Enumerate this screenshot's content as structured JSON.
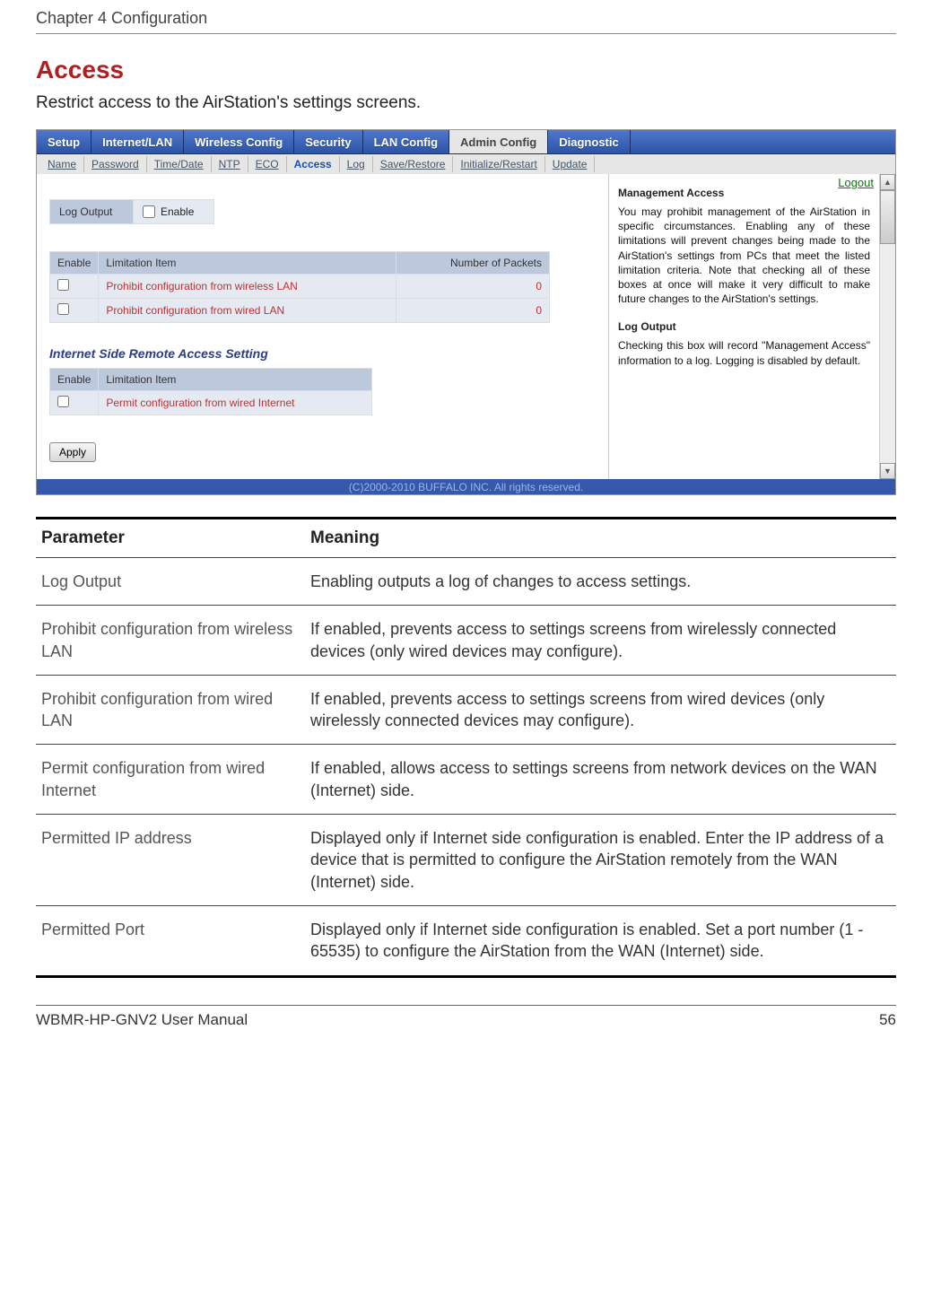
{
  "page_header": {
    "chapter": "Chapter 4  Configuration"
  },
  "section": {
    "title": "Access",
    "description": "Restrict access to the AirStation's settings screens."
  },
  "tabs": {
    "setup": "Setup",
    "internet_lan": "Internet/LAN",
    "wireless": "Wireless Config",
    "security": "Security",
    "lan_config": "LAN Config",
    "admin_config": "Admin Config",
    "diagnostic": "Diagnostic"
  },
  "subtabs": {
    "name": "Name",
    "password": "Password",
    "time_date": "Time/Date",
    "ntp": "NTP",
    "eco": "ECO",
    "access": "Access",
    "log": "Log",
    "save_restore": "Save/Restore",
    "initialize_restart": "Initialize/Restart",
    "update": "Update"
  },
  "logout": "Logout",
  "main": {
    "log_output": {
      "label": "Log Output",
      "enable_label": "Enable"
    },
    "columns": {
      "enable": "Enable",
      "limitation": "Limitation Item",
      "packets": "Number of Packets"
    },
    "management_rows": [
      {
        "text": "Prohibit configuration from wireless LAN",
        "packets": "0"
      },
      {
        "text": "Prohibit configuration from wired LAN",
        "packets": "0"
      }
    ],
    "remote_heading": "Internet Side Remote Access Setting",
    "remote_rows": [
      {
        "text": "Permit configuration from wired Internet"
      }
    ],
    "apply": "Apply"
  },
  "side": {
    "h1": "Management Access",
    "p1": "You may prohibit management of the AirStation in specific circumstances. Enabling any of these limitations will prevent changes being made to the AirStation's settings from PCs that meet the listed limitation criteria. Note that checking all of these boxes at once will make it very difficult to make future changes to the AirStation's settings.",
    "h2": "Log Output",
    "p2": "Checking this box will record \"Management Access\" information to a log. Logging is disabled by default."
  },
  "copyright": "(C)2000-2010 BUFFALO INC. All rights reserved.",
  "param_table": {
    "headers": {
      "param": "Parameter",
      "meaning": "Meaning"
    },
    "rows": [
      {
        "param": "Log Output",
        "meaning": "Enabling outputs a log of changes to access settings."
      },
      {
        "param": "Prohibit configuration from wireless LAN",
        "meaning": "If enabled, prevents access to settings screens from wirelessly connected devices (only wired devices may configure)."
      },
      {
        "param": "Prohibit configuration from wired LAN",
        "meaning": "If enabled, prevents access to settings screens from wired devices (only wirelessly connected devices may configure)."
      },
      {
        "param": "Permit configuration from wired Internet",
        "meaning": "If enabled, allows access to settings screens from network devices on the WAN (Internet) side."
      },
      {
        "param": "Permitted IP address",
        "meaning": "Displayed only if Internet side configuration is enabled. Enter the IP address of a device that is permitted to configure the AirStation remotely from the WAN (Internet) side."
      },
      {
        "param": "Permitted Port",
        "meaning": "Displayed only if Internet side configuration is enabled. Set a port number (1 - 65535) to configure the AirStation from the WAN (Internet) side."
      }
    ]
  },
  "footer": {
    "product": "WBMR-HP-GNV2 User Manual",
    "page": "56"
  }
}
